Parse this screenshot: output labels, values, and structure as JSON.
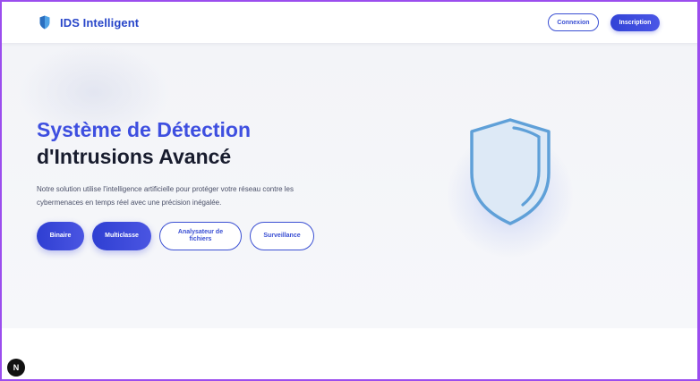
{
  "header": {
    "brand": "IDS Intelligent",
    "logo_icon": "shield-icon",
    "login_label": "Connexion",
    "signup_label": "Inscription"
  },
  "hero": {
    "title_line1": "Système de Détection",
    "title_line2": "d'Intrusions Avancé",
    "description": "Notre solution utilise l'intelligence artificielle pour protéger votre réseau contre les cybermenaces en temps réel avec une précision inégalée.",
    "buttons": [
      {
        "label": "Binaire",
        "style": "filled"
      },
      {
        "label": "Multiclasse",
        "style": "filled"
      },
      {
        "label": "Analysateur de fichiers",
        "style": "outline"
      },
      {
        "label": "Surveillance",
        "style": "outline"
      }
    ],
    "illustration_icon": "shield-icon"
  },
  "dev_badge": {
    "label": "N"
  },
  "colors": {
    "accent": "#3e4fe0",
    "frame": "#9b4dee",
    "shield": "#5fa0d8",
    "hero_bg": "#f4f5f9"
  }
}
